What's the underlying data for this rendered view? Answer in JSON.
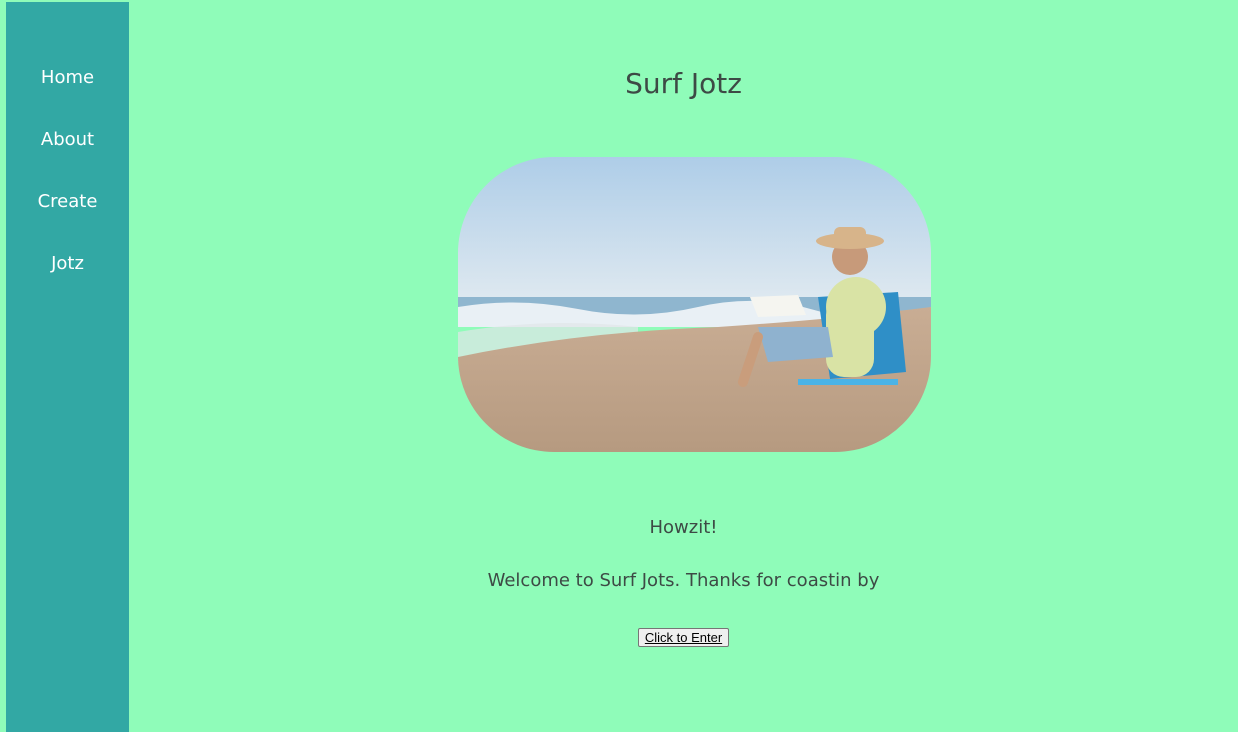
{
  "sidebar": {
    "items": [
      {
        "label": "Home"
      },
      {
        "label": "About"
      },
      {
        "label": "Create"
      },
      {
        "label": "Jotz"
      }
    ]
  },
  "main": {
    "title": "Surf Jotz",
    "greeting": "Howzit!",
    "welcome": "Welcome to Surf Jots. Thanks for coastin by",
    "enter_button": "Click to Enter"
  },
  "colors": {
    "page_background": "#8ffcb9",
    "sidebar_background": "#32a8a4",
    "nav_text": "#ffffff",
    "body_text": "#3d4a45"
  },
  "hero_image": {
    "icon": "beach-photo"
  }
}
